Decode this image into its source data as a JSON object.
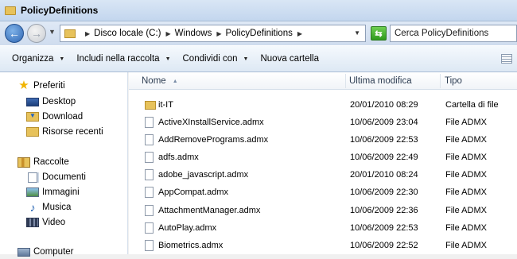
{
  "window": {
    "title": "PolicyDefinitions"
  },
  "address": {
    "breadcrumbs": [
      "Disco locale (C:)",
      "Windows",
      "PolicyDefinitions"
    ],
    "search_placeholder": "Cerca PolicyDefinitions"
  },
  "toolbar": {
    "organize": "Organizza",
    "include": "Includi nella raccolta",
    "share": "Condividi con",
    "new_folder": "Nuova cartella"
  },
  "sidebar": {
    "favorites_label": "Preferiti",
    "favorites": [
      "Desktop",
      "Download",
      "Risorse recenti"
    ],
    "libraries_label": "Raccolte",
    "libraries": [
      "Documenti",
      "Immagini",
      "Musica",
      "Video"
    ],
    "computer_label": "Computer"
  },
  "columns": {
    "name": "Nome",
    "modified": "Ultima modifica",
    "type": "Tipo"
  },
  "files": [
    {
      "name": "it-IT",
      "modified": "20/01/2010 08:29",
      "type": "Cartella di file",
      "kind": "folder"
    },
    {
      "name": "ActiveXInstallService.admx",
      "modified": "10/06/2009 23:04",
      "type": "File ADMX",
      "kind": "file"
    },
    {
      "name": "AddRemovePrograms.admx",
      "modified": "10/06/2009 22:53",
      "type": "File ADMX",
      "kind": "file"
    },
    {
      "name": "adfs.admx",
      "modified": "10/06/2009 22:49",
      "type": "File ADMX",
      "kind": "file"
    },
    {
      "name": "adobe_javascript.admx",
      "modified": "20/01/2010 08:24",
      "type": "File ADMX",
      "kind": "file"
    },
    {
      "name": "AppCompat.admx",
      "modified": "10/06/2009 22:30",
      "type": "File ADMX",
      "kind": "file"
    },
    {
      "name": "AttachmentManager.admx",
      "modified": "10/06/2009 22:36",
      "type": "File ADMX",
      "kind": "file"
    },
    {
      "name": "AutoPlay.admx",
      "modified": "10/06/2009 22:53",
      "type": "File ADMX",
      "kind": "file"
    },
    {
      "name": "Biometrics.admx",
      "modified": "10/06/2009 22:52",
      "type": "File ADMX",
      "kind": "file"
    }
  ]
}
